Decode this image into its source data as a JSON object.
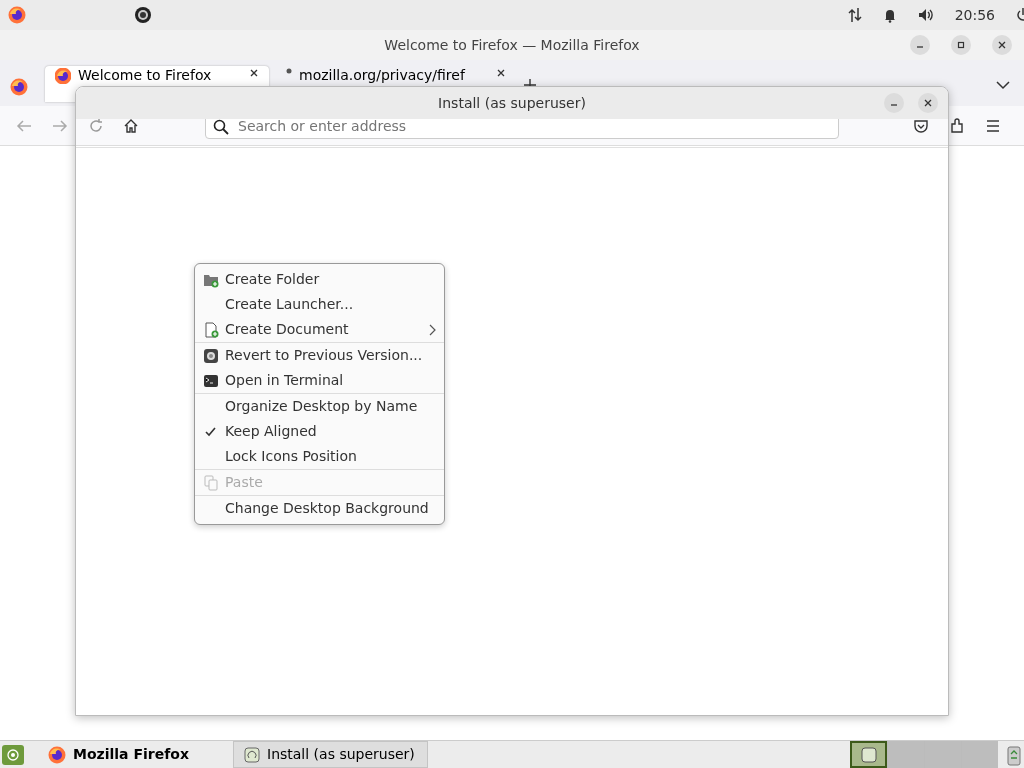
{
  "top_panel": {
    "clock": "20:56"
  },
  "browser": {
    "title": "Welcome to Firefox — Mozilla Firefox",
    "tabs": [
      {
        "label": "Welcome to Firefox",
        "selected": true,
        "kind": "firefox"
      },
      {
        "label": "mozilla.org/privacy/firef",
        "selected": false,
        "kind": "loading"
      }
    ],
    "address": {
      "placeholder": "Search or enter address"
    }
  },
  "dialog": {
    "title": "Install (as superuser)"
  },
  "context_menu": {
    "groups": [
      [
        {
          "label": "Create Folder",
          "kind": "folder",
          "checked": false,
          "disabled": false,
          "submenu": false
        },
        {
          "label": "Create Launcher...",
          "kind": "plain",
          "checked": false,
          "disabled": false,
          "submenu": false
        },
        {
          "label": "Create Document",
          "kind": "document",
          "checked": false,
          "disabled": false,
          "submenu": true
        }
      ],
      [
        {
          "label": "Revert to Previous Version...",
          "kind": "revert",
          "checked": false,
          "disabled": false,
          "submenu": false
        },
        {
          "label": "Open in Terminal",
          "kind": "terminal",
          "checked": false,
          "disabled": false,
          "submenu": false
        }
      ],
      [
        {
          "label": "Organize Desktop by Name",
          "kind": "plain",
          "checked": false,
          "disabled": false,
          "submenu": false
        },
        {
          "label": "Keep Aligned",
          "kind": "plain",
          "checked": true,
          "disabled": false,
          "submenu": false
        },
        {
          "label": "Lock Icons Position",
          "kind": "plain",
          "checked": false,
          "disabled": false,
          "submenu": false
        }
      ],
      [
        {
          "label": "Paste",
          "kind": "paste",
          "checked": false,
          "disabled": true,
          "submenu": false
        }
      ],
      [
        {
          "label": "Change Desktop Background",
          "kind": "plain",
          "checked": false,
          "disabled": false,
          "submenu": false
        }
      ]
    ]
  },
  "taskbar": {
    "tasks": [
      {
        "label": "Mozilla Firefox",
        "selected": false,
        "kind": "firefox"
      },
      {
        "label": "Install (as superuser)",
        "selected": true,
        "kind": "installer"
      }
    ],
    "workspaces": [
      {
        "selected": true
      },
      {
        "selected": false
      },
      {
        "selected": false
      },
      {
        "selected": false
      }
    ]
  }
}
